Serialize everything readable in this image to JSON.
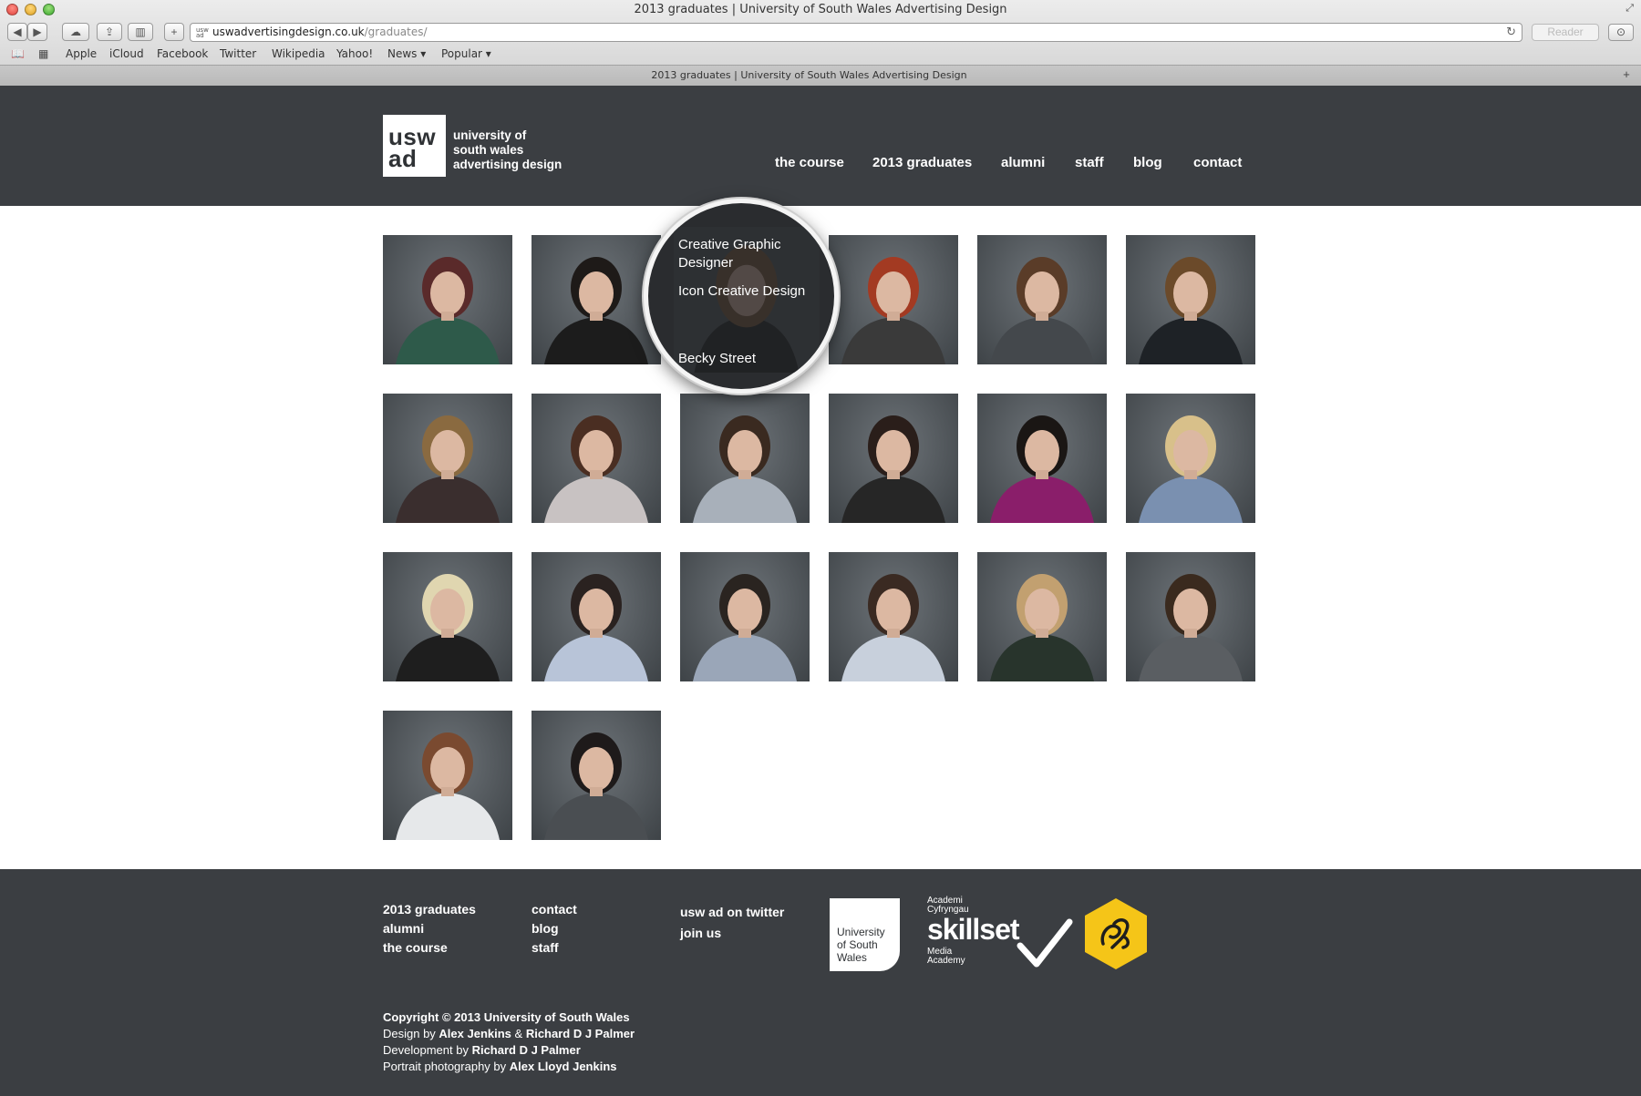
{
  "browser": {
    "window_title": "2013 graduates | University of South Wales Advertising Design",
    "tab_title": "2013 graduates | University of South Wales Advertising Design",
    "url_domain": "uswadvertisingdesign.co.uk",
    "url_path": "/graduates/",
    "reader_label": "Reader",
    "bookmarks": [
      "Apple",
      "iCloud",
      "Facebook",
      "Twitter",
      "Wikipedia",
      "Yahoo!",
      "News ▾",
      "Popular ▾"
    ]
  },
  "site": {
    "logo_line1": "usw",
    "logo_line2": "ad",
    "logo_text_1": "university of",
    "logo_text_2": "south wales",
    "logo_text_3": "advertising design",
    "nav": [
      "the course",
      "2013 graduates",
      "alumni",
      "staff",
      "blog",
      "contact"
    ]
  },
  "graduates": {
    "count": 20,
    "hover": {
      "job_title": "Creative Graphic Designer",
      "company": "Icon Creative Design",
      "name": "Becky Street"
    }
  },
  "footer": {
    "col1": [
      "2013 graduates",
      "alumni",
      "the course"
    ],
    "col2": [
      "contact",
      "blog",
      "staff"
    ],
    "col3": [
      "usw ad on twitter",
      "join us"
    ],
    "usw_logo": [
      "University",
      "of South",
      "Wales"
    ],
    "skillset_top1": "Academi",
    "skillset_top2": "Cyfryngau",
    "skillset_word": "skillset",
    "skillset_bottom1": "Media",
    "skillset_bottom2": "Academy",
    "copyright": "Copyright © 2013 University of South Wales",
    "design_prefix": "Design by ",
    "design_name1": "Alex Jenkins",
    "design_amp": " & ",
    "design_name2": "Richard D J Palmer",
    "dev_prefix": "Development by ",
    "dev_name": "Richard D J Palmer",
    "photo_prefix": "Portrait photography by ",
    "photo_name": "Alex Lloyd Jenkins"
  },
  "colors": {
    "header_bg": "#3b3e42",
    "dad_yellow": "#f5c518"
  }
}
